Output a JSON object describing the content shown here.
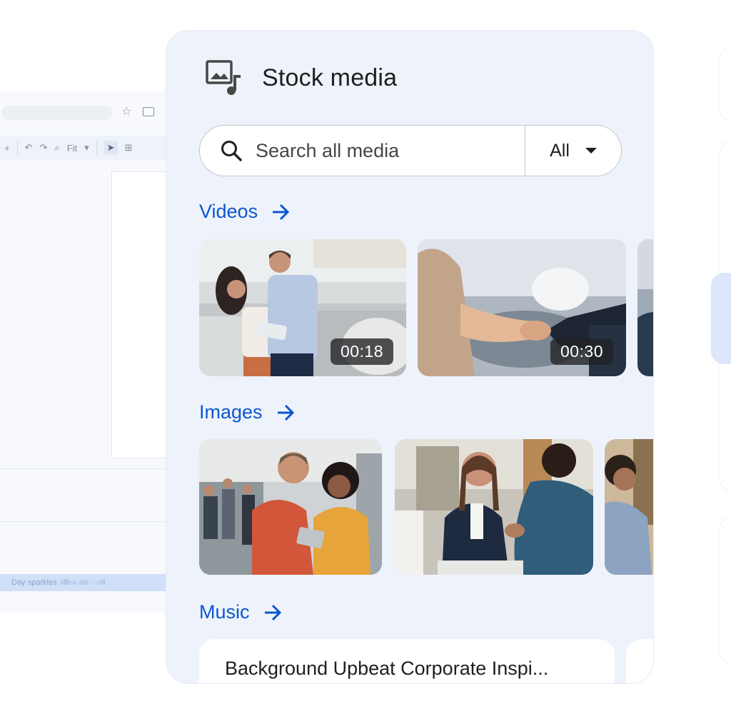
{
  "panel": {
    "title": "Stock media",
    "icon": "stock-media-icon"
  },
  "search": {
    "placeholder": "Search all media",
    "filter_value": "All"
  },
  "sections": {
    "videos": {
      "label": "Videos",
      "items": [
        {
          "duration": "00:18"
        },
        {
          "duration": "00:30"
        }
      ]
    },
    "images": {
      "label": "Images"
    },
    "music": {
      "label": "Music",
      "items": [
        {
          "title": "Background Upbeat Corporate Inspi..."
        }
      ]
    }
  },
  "background_editor": {
    "zoom_label": "Fit",
    "audio_clip_label": "Day sparkles"
  },
  "colors": {
    "accent": "#0b57d0",
    "panel_bg": "#eef3fb",
    "text": "#1f1f1f"
  }
}
